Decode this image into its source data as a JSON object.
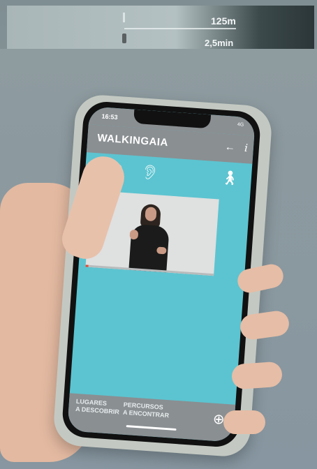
{
  "wall_sign": {
    "distance": "125m",
    "time": "2,5min"
  },
  "status_bar": {
    "time": "16:53",
    "network": "4G"
  },
  "header": {
    "logo": "WALKINGAIA",
    "back_icon": "arrow-left-icon",
    "info_icon": "info-icon"
  },
  "toolbar": {
    "sound_icon": "speaker-icon",
    "hearing_icon": "ear-icon",
    "walk_icon": "pedestrian-icon"
  },
  "video": {
    "progress_percent": 2,
    "progress_color": "#e4482f"
  },
  "bottom_nav": {
    "items": [
      {
        "label_line1": "LUGARES",
        "label_line2": "A DESCOBRIR"
      },
      {
        "label_line1": "PERCURSOS",
        "label_line2": "A ENCONTRAR"
      }
    ],
    "locate_icon": "crosshair-icon"
  },
  "colors": {
    "accent": "#5cc4d0",
    "bar": "#8a8f92"
  }
}
